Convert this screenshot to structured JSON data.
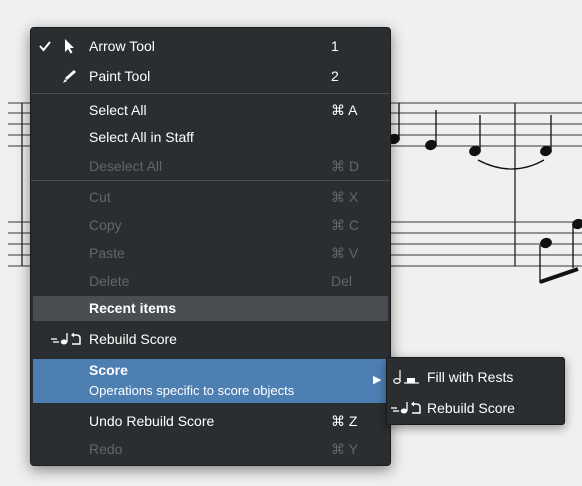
{
  "menu": {
    "items": [
      {
        "label": "Arrow Tool",
        "shortcut": "1",
        "checked": true,
        "icon": "arrow-cursor-icon"
      },
      {
        "label": "Paint Tool",
        "shortcut": "2",
        "icon": "paintbrush-icon"
      },
      {
        "label": "Select All",
        "shortcut": "⌘ A"
      },
      {
        "label": "Select All in Staff",
        "shortcut": ""
      },
      {
        "label": "Deselect All",
        "shortcut": "⌘ D",
        "disabled": true
      },
      {
        "label": "Cut",
        "shortcut": "⌘ X",
        "disabled": true
      },
      {
        "label": "Copy",
        "shortcut": "⌘ C",
        "disabled": true
      },
      {
        "label": "Paste",
        "shortcut": "⌘ V",
        "disabled": true
      },
      {
        "label": "Delete",
        "shortcut": "Del",
        "disabled": true
      }
    ],
    "recent_header": "Recent items",
    "recent_item": {
      "label": "Rebuild Score",
      "icon": "rebuild-score-icon"
    },
    "score": {
      "label": "Score",
      "description": "Operations specific to score objects"
    },
    "undo": {
      "label": "Undo Rebuild Score",
      "shortcut": "⌘ Z"
    },
    "redo": {
      "label": "Redo",
      "shortcut": "⌘ Y",
      "disabled": true
    }
  },
  "submenu": {
    "items": [
      {
        "label": "Fill with Rests",
        "icon": "fill-rests-icon"
      },
      {
        "label": "Rebuild Score",
        "icon": "rebuild-score-icon"
      }
    ]
  },
  "colors": {
    "menu_bg": "#2b2e31",
    "selection": "#4e7fb2",
    "header_bg": "#4a4e52",
    "disabled_text": "#62666a"
  }
}
